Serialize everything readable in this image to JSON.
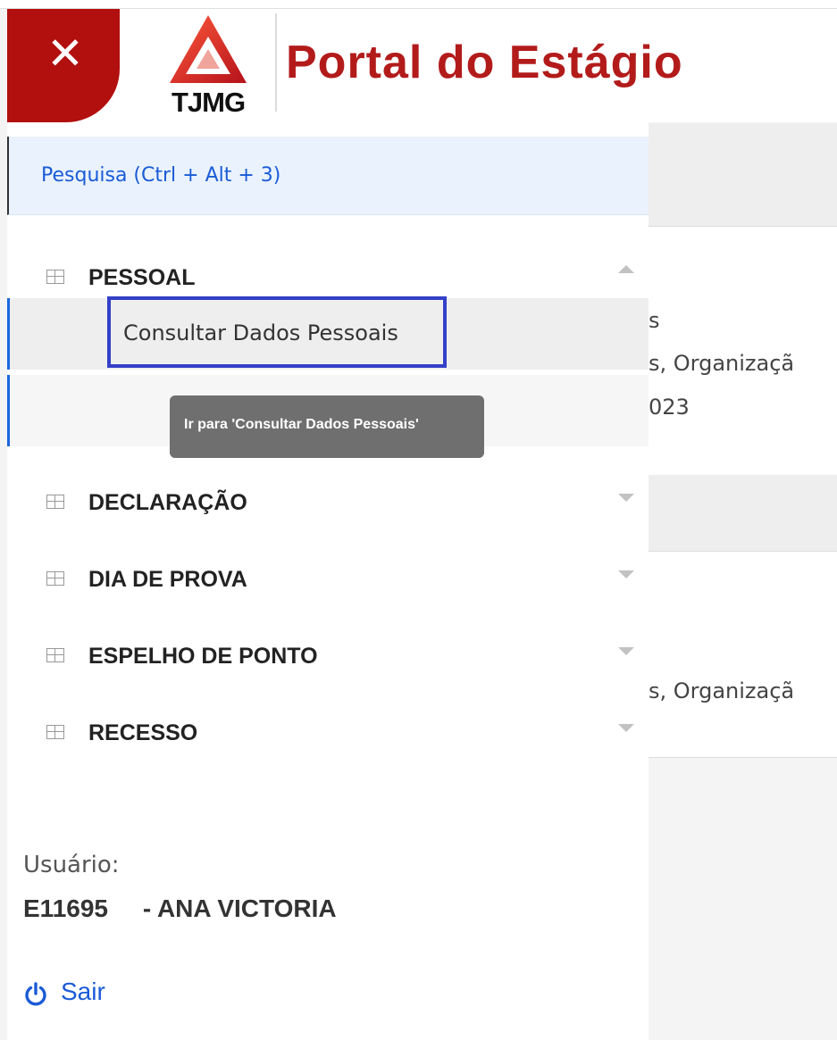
{
  "header": {
    "title": "Portal do Estágio",
    "logo_text": "TJMG",
    "close_symbol": "✕"
  },
  "search": {
    "label": "Pesquisa (Ctrl + Alt + 3)"
  },
  "menu": {
    "sections": [
      {
        "label": "PESSOAL",
        "expanded": true
      },
      {
        "label": "DECLARAÇÃO",
        "expanded": false
      },
      {
        "label": "DIA DE PROVA",
        "expanded": false
      },
      {
        "label": "ESPELHO DE PONTO",
        "expanded": false
      },
      {
        "label": "RECESSO",
        "expanded": false
      }
    ],
    "subitem": "Consultar Dados Pessoais",
    "tooltip": "Ir para 'Consultar Dados Pessoais'"
  },
  "user": {
    "label": "Usuário:",
    "value": "E11695     - ANA VICTORIA"
  },
  "logout": {
    "label": "Sair"
  },
  "background_text": {
    "line1": "s",
    "line2": "s, Organizaçã",
    "line3": "023",
    "line4": "s, Organizaçã"
  },
  "colors": {
    "brand_red": "#b20f0f",
    "title_red": "#b31b1b",
    "link_blue": "#1a5bd6",
    "focus_blue": "#3340c8"
  },
  "icons": [
    "close-icon",
    "tjmg-logo",
    "table-icon",
    "chevron-up-icon",
    "chevron-down-icon",
    "power-icon"
  ]
}
